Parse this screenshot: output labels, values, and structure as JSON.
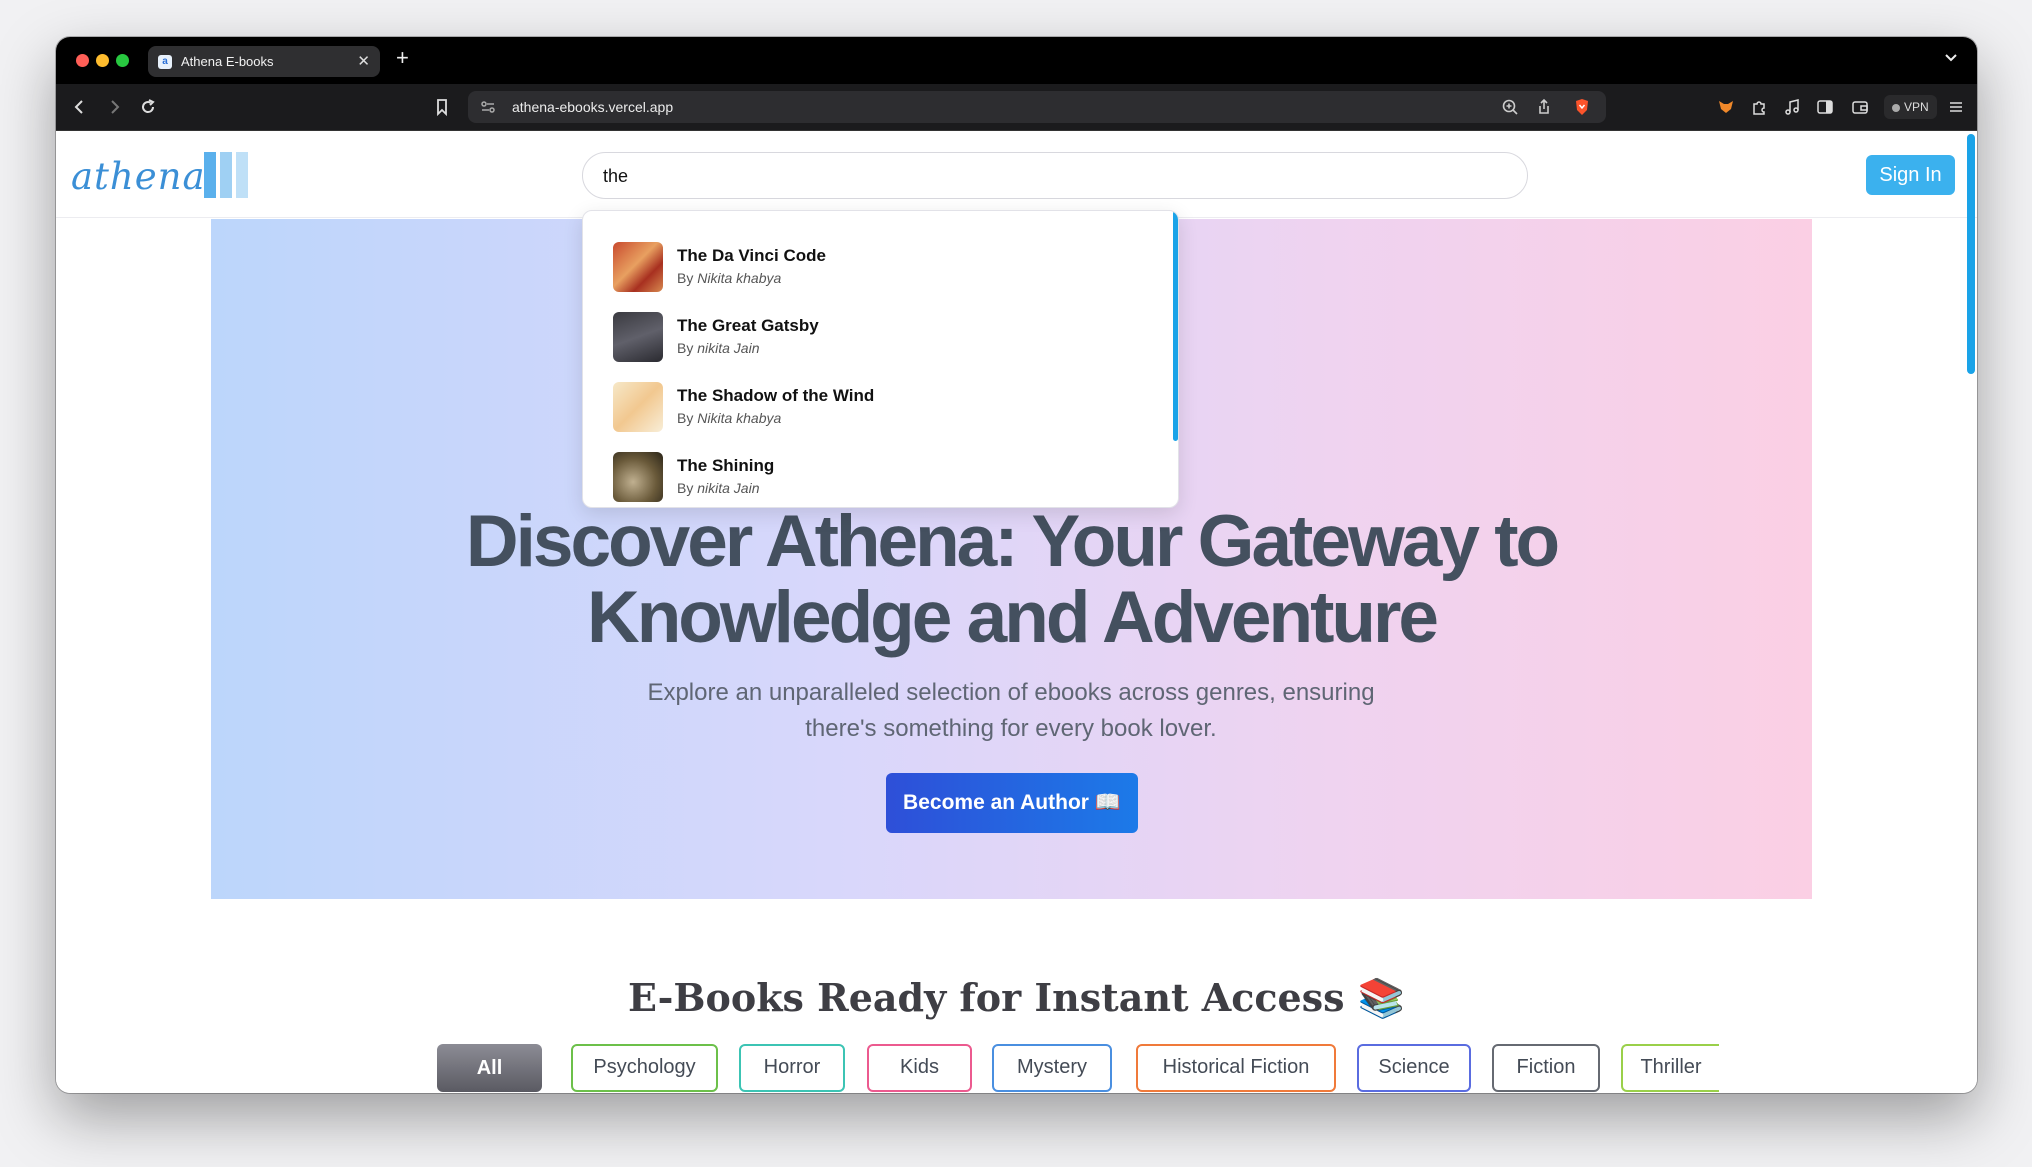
{
  "browser": {
    "tab_title": "Athena E-books",
    "url": "athena-ebooks.vercel.app",
    "vpn_label": "VPN"
  },
  "header": {
    "logo_text": "athena",
    "search_value": "the",
    "signin_label": "Sign In"
  },
  "search_results": [
    {
      "title": "The Da Vinci Code",
      "by": "By",
      "author": "Nikita khabya"
    },
    {
      "title": "The Great Gatsby",
      "by": "By",
      "author": "nikita Jain"
    },
    {
      "title": "The Shadow of the Wind",
      "by": "By",
      "author": "Nikita khabya"
    },
    {
      "title": "The Shining",
      "by": "By",
      "author": "nikita Jain"
    }
  ],
  "hero": {
    "title_line1": "Discover Athena: Your Gateway to",
    "title_line2": "Knowledge and Adventure",
    "subtitle": "Explore an unparalleled selection of ebooks across genres, ensuring there's something for every book lover.",
    "cta_label": "Become an Author 📖"
  },
  "section": {
    "title": "E-Books Ready for Instant Access 📚"
  },
  "genres": [
    "All",
    "Psychology",
    "Horror",
    "Kids",
    "Mystery",
    "Historical Fiction",
    "Science",
    "Fiction",
    "Thriller"
  ],
  "colors": {
    "accent": "#3bb1ee",
    "cta": "#2e4fd8",
    "genre_borders": [
      "#6cc04a",
      "#3cc4b4",
      "#ec5a8f",
      "#4a8fe0",
      "#f07a3a",
      "#5a6ce0",
      "#666a72",
      "#9ad04a"
    ]
  }
}
